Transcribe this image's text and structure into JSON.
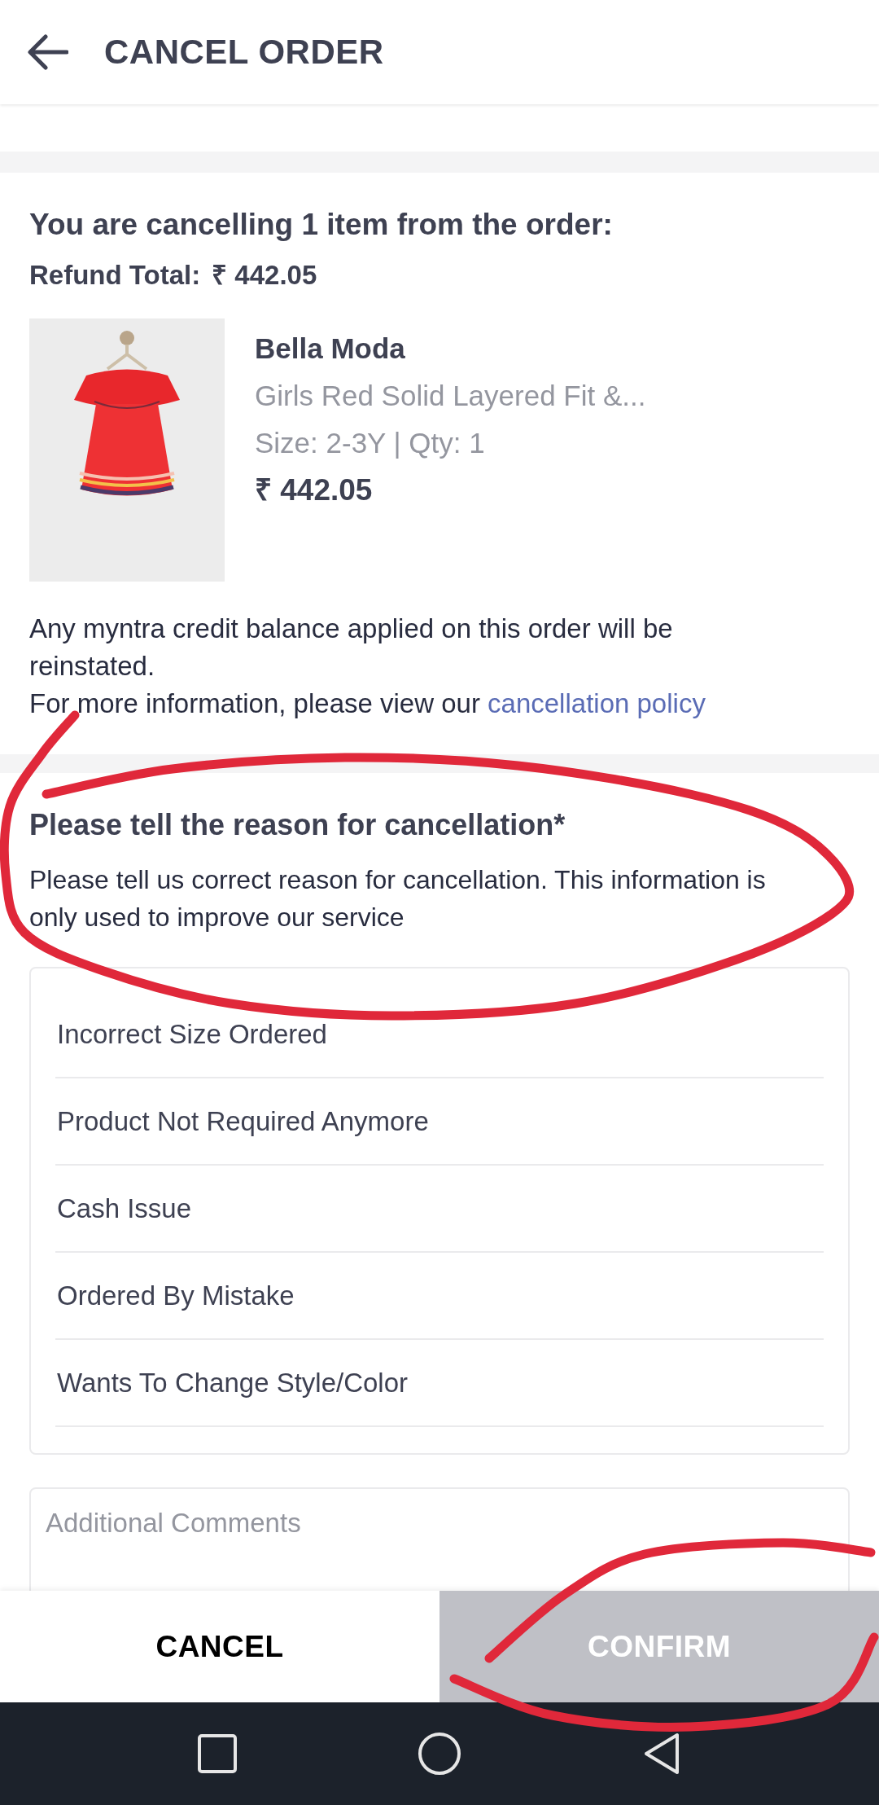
{
  "header": {
    "title": "CANCEL ORDER"
  },
  "summary": {
    "title": "You are cancelling 1 item from the order:",
    "refund_label": "Refund Total:",
    "refund_amount": "₹ 442.05"
  },
  "item": {
    "brand": "Bella Moda",
    "name": "Girls Red Solid Layered Fit &...",
    "size_qty": "Size: 2-3Y | Qty: 1",
    "price": "₹ 442.05"
  },
  "note": {
    "text": "Any myntra credit balance applied on this order will be reinstated.",
    "more": "For more information, please view our",
    "link": "cancellation policy"
  },
  "reason": {
    "title": "Please tell the reason for cancellation*",
    "description": "Please tell us correct reason for cancellation. This information is only used to improve our service"
  },
  "reasons": [
    {
      "label": "Incorrect Size Ordered",
      "selected": false
    },
    {
      "label": "Product Not Required Anymore",
      "selected": false
    },
    {
      "label": "Cash Issue",
      "selected": false
    },
    {
      "label": "Ordered By Mistake",
      "selected": false
    },
    {
      "label": "Wants To Change Style/Color",
      "selected": false
    }
  ],
  "comments": {
    "placeholder": "Additional Comments"
  },
  "actions": [
    {
      "label": "CANCEL",
      "disabled": false
    },
    {
      "label": "CONFIRM",
      "disabled": true
    }
  ]
}
